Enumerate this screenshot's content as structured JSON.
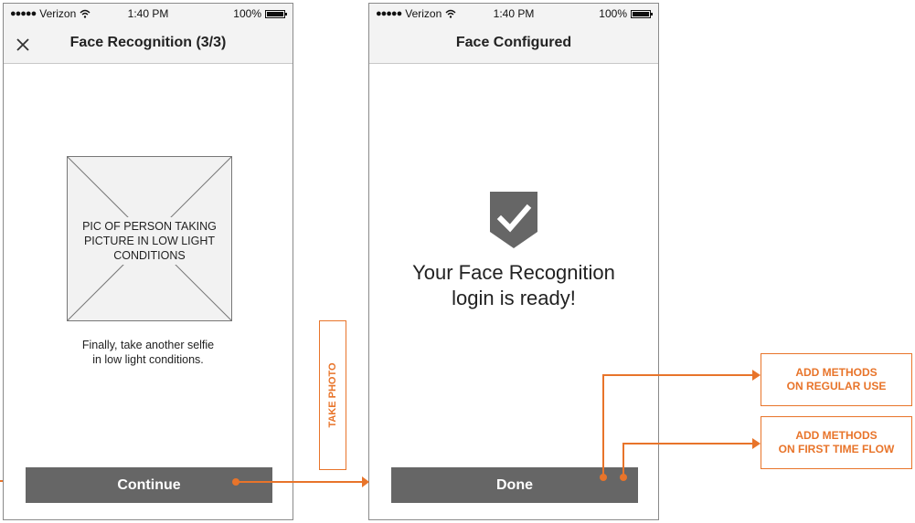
{
  "status_bar": {
    "carrier": "Verizon",
    "time": "1:40 PM",
    "battery": "100%"
  },
  "screen1": {
    "title": "Face Recognition (3/3)",
    "placeholder_lines": [
      "PIC OF PERSON TAKING",
      "PICTURE IN LOW LIGHT",
      "CONDITIONS"
    ],
    "instruction_lines": [
      "Finally, take another selfie",
      "in low light conditions."
    ],
    "button_label": "Continue"
  },
  "screen2": {
    "title": "Face Configured",
    "message_lines": [
      "Your Face Recognition",
      "login is ready!"
    ],
    "button_label": "Done"
  },
  "annotations": {
    "take_photo": "TAKE PHOTO",
    "regular_use": [
      "ADD METHODS",
      "ON REGULAR USE"
    ],
    "first_time": [
      "ADD METHODS",
      "ON FIRST TIME FLOW"
    ]
  },
  "colors": {
    "annotation": "#e8742a",
    "button": "#666666",
    "bar": "#f3f3f3"
  },
  "icons": [
    "close-icon",
    "wifi-icon",
    "battery-icon",
    "shield-check-icon"
  ]
}
